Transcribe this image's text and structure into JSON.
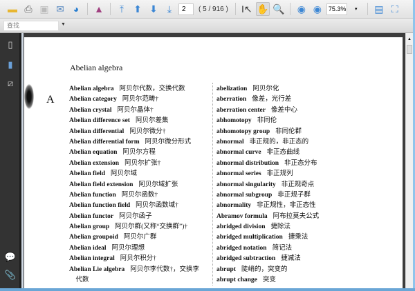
{
  "toolbar": {
    "page_value": "2",
    "page_count": "( 5 / 916 )",
    "zoom_value": "75.3%"
  },
  "find": {
    "placeholder": "查找"
  },
  "document": {
    "header": "Abelian algebra",
    "section_letter": "A",
    "left_entries": [
      {
        "en": "Abelian algebra",
        "zh": "阿贝尔代数，交换代数"
      },
      {
        "en": "Abelian category",
        "zh": "阿贝尔范畴†"
      },
      {
        "en": "Abelian crystal",
        "zh": "阿贝尔晶体†"
      },
      {
        "en": "Abelian difference set",
        "zh": "阿贝尔差集"
      },
      {
        "en": "Abelian differential",
        "zh": "阿贝尔微分†"
      },
      {
        "en": "Abelian differential form",
        "zh": "阿贝尔微分形式"
      },
      {
        "en": "Abelian equation",
        "zh": "阿贝尔方程"
      },
      {
        "en": "Abelian extension",
        "zh": "阿贝尔扩张†"
      },
      {
        "en": "Abelian field",
        "zh": "阿贝尔域"
      },
      {
        "en": "Abelian field extension",
        "zh": "阿贝尔域扩张"
      },
      {
        "en": "Abelian function",
        "zh": "阿贝尔函数†"
      },
      {
        "en": "Abelian function field",
        "zh": "阿贝尔函数域†"
      },
      {
        "en": "Abelian functor",
        "zh": "阿贝尔函子"
      },
      {
        "en": "Abelian group",
        "zh": "阿贝尔群(又称“交换群”)†"
      },
      {
        "en": "Abelian groupoid",
        "zh": "阿贝尔广群"
      },
      {
        "en": "Abelian ideal",
        "zh": "阿贝尔理想"
      },
      {
        "en": "Abelian integral",
        "zh": "阿贝尔积分†"
      },
      {
        "en": "Abelian Lie algebra",
        "zh": "阿贝尔李代数†，交换李"
      },
      {
        "en": "",
        "zh": "　代数"
      }
    ],
    "right_entries": [
      {
        "en": "abelization",
        "zh": "阿贝尔化"
      },
      {
        "en": "aberration",
        "zh": "像差，光行差"
      },
      {
        "en": "aberration center",
        "zh": "像差中心"
      },
      {
        "en": "abhomotopy",
        "zh": "非同伦"
      },
      {
        "en": "abhomotopy group",
        "zh": "非同伦群"
      },
      {
        "en": "abnormal",
        "zh": "非正规的，非正态的"
      },
      {
        "en": "abnormal curve",
        "zh": "非正态曲线"
      },
      {
        "en": "abnormal distribution",
        "zh": "非正态分布"
      },
      {
        "en": "abnormal series",
        "zh": "非正规列"
      },
      {
        "en": "abnormal singularity",
        "zh": "非正规奇点"
      },
      {
        "en": "abnormal subgroup",
        "zh": "非正规子群"
      },
      {
        "en": "abnormality",
        "zh": "非正规性，非正态性"
      },
      {
        "en": "Abramov formula",
        "zh": "阿布拉莫夫公式"
      },
      {
        "en": "abridged division",
        "zh": "捷除法"
      },
      {
        "en": "abridged multiplication",
        "zh": "捷乘法"
      },
      {
        "en": "abridged notation",
        "zh": "简记法"
      },
      {
        "en": "abridged subtraction",
        "zh": "捷减法"
      },
      {
        "en": "abrupt",
        "zh": "陡峭的，突变的"
      },
      {
        "en": "abrupt change",
        "zh": "突变"
      }
    ]
  }
}
